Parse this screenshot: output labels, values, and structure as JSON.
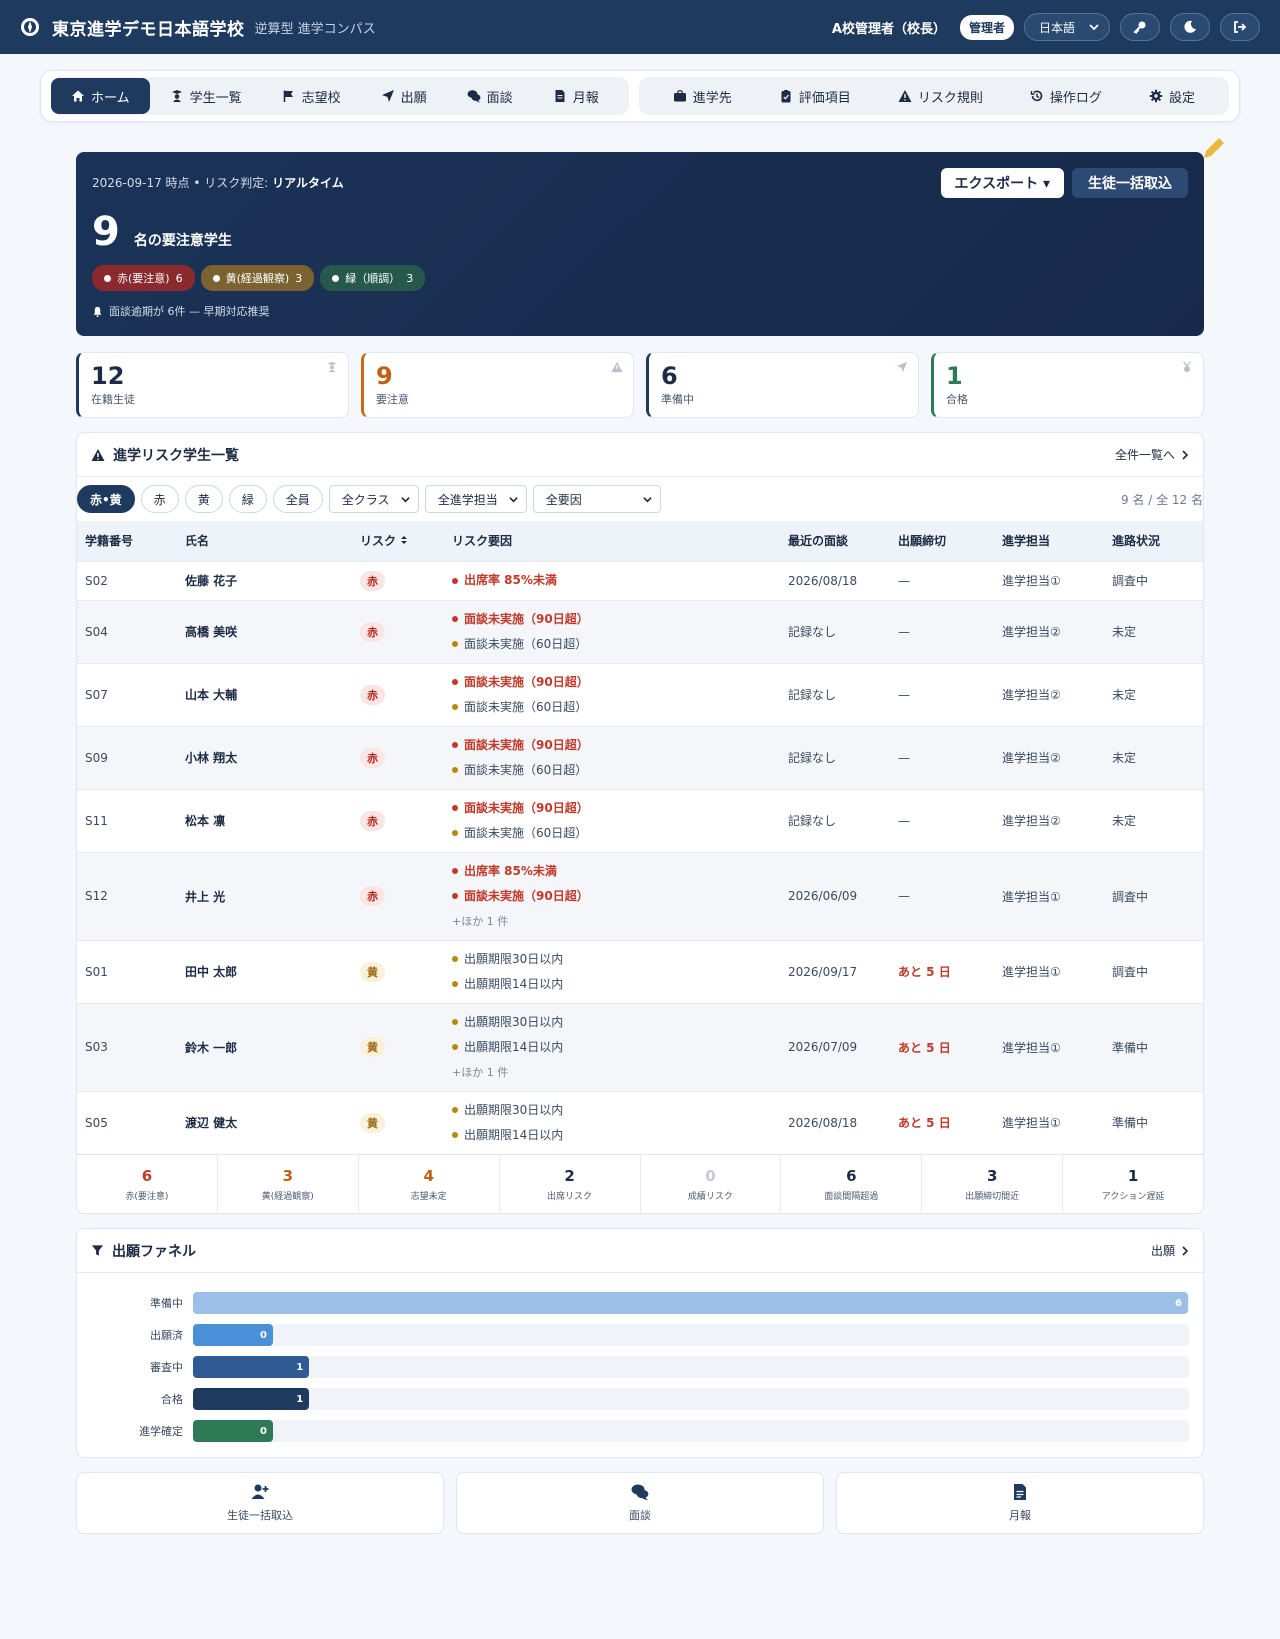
{
  "header": {
    "title": "東京進学デモ日本語学校",
    "subtitle": "逆算型 進学コンパス",
    "user": "A校管理者（校長）",
    "role": "管理者",
    "language": "日本語"
  },
  "nav": {
    "group1": [
      {
        "label": "ホーム",
        "icon": "home-icon",
        "active": true
      },
      {
        "label": "学生一覧",
        "icon": "student-icon"
      },
      {
        "label": "志望校",
        "icon": "flag-icon"
      },
      {
        "label": "出願",
        "icon": "send-icon"
      },
      {
        "label": "面談",
        "icon": "chat-icon"
      },
      {
        "label": "月報",
        "icon": "document-icon"
      }
    ],
    "group2": [
      {
        "label": "進学先",
        "icon": "briefcase-icon"
      },
      {
        "label": "評価項目",
        "icon": "clipboard-icon"
      },
      {
        "label": "リスク規則",
        "icon": "warning-icon"
      },
      {
        "label": "操作ログ",
        "icon": "history-icon"
      },
      {
        "label": "設定",
        "icon": "gear-icon"
      }
    ]
  },
  "hero": {
    "meta_prefix": "2026-09-17 時点 • リスク判定: ",
    "meta_mode": "リアルタイム",
    "count": "9",
    "count_label": "名の要注意学生",
    "pills": [
      {
        "label": "赤(要注意)",
        "count": "6",
        "tone": "red"
      },
      {
        "label": "黄(経過観察)",
        "count": "3",
        "tone": "yellow"
      },
      {
        "label": "緑（順調）",
        "count": "3",
        "tone": "green"
      }
    ],
    "note": "面談逾期が 6件 — 早期対応推奨",
    "export_label": "エクスポート ▾",
    "import_label": "生徒一括取込"
  },
  "kpis": [
    {
      "value": "12",
      "label": "在籍生徒",
      "tone": "navy",
      "icon": "student-icon"
    },
    {
      "value": "9",
      "label": "要注意",
      "tone": "orange",
      "icon": "warning-icon"
    },
    {
      "value": "6",
      "label": "準備中",
      "tone": "navy",
      "icon": "send-icon"
    },
    {
      "value": "1",
      "label": "合格",
      "tone": "green",
      "icon": "medal-icon"
    }
  ],
  "risk_list": {
    "title": "進学リスク学生一覧",
    "link": "全件一覧へ",
    "chips": [
      "赤•黄",
      "赤",
      "黄",
      "緑",
      "全員"
    ],
    "selects": [
      "全クラス",
      "全進学担当",
      "全要因"
    ],
    "count_text": "9 名 / 全 12 名",
    "columns": [
      "学籍番号",
      "氏名",
      "リスク",
      "リスク要因",
      "最近の面談",
      "出願締切",
      "進学担当",
      "進路状況"
    ],
    "rows": [
      {
        "id": "S02",
        "name": "佐藤 花子",
        "risk": "赤",
        "tone": "red",
        "factors": [
          [
            "sev",
            "出席率 85%未満"
          ]
        ],
        "more": "",
        "last": "2026/08/18",
        "deadline": "—",
        "dl_red": false,
        "staff": "進学担当①",
        "status": "調査中"
      },
      {
        "id": "S04",
        "name": "高橋 美咲",
        "risk": "赤",
        "tone": "red",
        "factors": [
          [
            "sev",
            "面談未実施（90日超）"
          ],
          [
            "mild",
            "面談未実施（60日超）"
          ]
        ],
        "more": "",
        "last": "記録なし",
        "deadline": "—",
        "dl_red": false,
        "staff": "進学担当②",
        "status": "未定"
      },
      {
        "id": "S07",
        "name": "山本 大輔",
        "risk": "赤",
        "tone": "red",
        "factors": [
          [
            "sev",
            "面談未実施（90日超）"
          ],
          [
            "mild",
            "面談未実施（60日超）"
          ]
        ],
        "more": "",
        "last": "記録なし",
        "deadline": "—",
        "dl_red": false,
        "staff": "進学担当②",
        "status": "未定"
      },
      {
        "id": "S09",
        "name": "小林 翔太",
        "risk": "赤",
        "tone": "red",
        "factors": [
          [
            "sev",
            "面談未実施（90日超）"
          ],
          [
            "mild",
            "面談未実施（60日超）"
          ]
        ],
        "more": "",
        "last": "記録なし",
        "deadline": "—",
        "dl_red": false,
        "staff": "進学担当②",
        "status": "未定"
      },
      {
        "id": "S11",
        "name": "松本 凛",
        "risk": "赤",
        "tone": "red",
        "factors": [
          [
            "sev",
            "面談未実施（90日超）"
          ],
          [
            "mild",
            "面談未実施（60日超）"
          ]
        ],
        "more": "",
        "last": "記録なし",
        "deadline": "—",
        "dl_red": false,
        "staff": "進学担当②",
        "status": "未定"
      },
      {
        "id": "S12",
        "name": "井上 光",
        "risk": "赤",
        "tone": "red",
        "factors": [
          [
            "sev",
            "出席率 85%未満"
          ],
          [
            "sev",
            "面談未実施（90日超）"
          ]
        ],
        "more": "+ほか 1 件",
        "last": "2026/06/09",
        "deadline": "—",
        "dl_red": false,
        "staff": "進学担当①",
        "status": "調査中"
      },
      {
        "id": "S01",
        "name": "田中 太郎",
        "risk": "黄",
        "tone": "yellow",
        "factors": [
          [
            "mild",
            "出願期限30日以内"
          ],
          [
            "mild",
            "出願期限14日以内"
          ]
        ],
        "more": "",
        "last": "2026/09/17",
        "deadline": "あと 5 日",
        "dl_red": true,
        "staff": "進学担当①",
        "status": "調査中"
      },
      {
        "id": "S03",
        "name": "鈴木 一郎",
        "risk": "黄",
        "tone": "yellow",
        "factors": [
          [
            "mild",
            "出願期限30日以内"
          ],
          [
            "mild",
            "出願期限14日以内"
          ]
        ],
        "more": "+ほか 1 件",
        "last": "2026/07/09",
        "deadline": "あと 5 日",
        "dl_red": true,
        "staff": "進学担当①",
        "status": "準備中"
      },
      {
        "id": "S05",
        "name": "渡辺 健太",
        "risk": "黄",
        "tone": "yellow",
        "factors": [
          [
            "mild",
            "出願期限30日以内"
          ],
          [
            "mild",
            "出願期限14日以内"
          ]
        ],
        "more": "",
        "last": "2026/08/18",
        "deadline": "あと 5 日",
        "dl_red": true,
        "staff": "進学担当①",
        "status": "準備中"
      }
    ],
    "summary": [
      {
        "value": "6",
        "label": "赤(要注意)",
        "color": "#c0392b"
      },
      {
        "value": "3",
        "label": "黄(経過観察)",
        "color": "#c06014"
      },
      {
        "value": "4",
        "label": "志望未定",
        "color": "#c06014"
      },
      {
        "value": "2",
        "label": "出席リスク",
        "color": "#1d2b44"
      },
      {
        "value": "0",
        "label": "成績リスク",
        "color": "#c5ccd6"
      },
      {
        "value": "6",
        "label": "面談間隔超過",
        "color": "#1d2b44"
      },
      {
        "value": "3",
        "label": "出願締切間近",
        "color": "#1d2b44"
      },
      {
        "value": "1",
        "label": "アクション遅延",
        "color": "#1d2b44"
      }
    ]
  },
  "funnel": {
    "title": "出願ファネル",
    "link": "出願",
    "max": 6,
    "stages": [
      {
        "label": "準備中",
        "value": 6,
        "color": "#9bbfe6"
      },
      {
        "label": "出願済",
        "value": 0,
        "color": "#4a90d9"
      },
      {
        "label": "審査中",
        "value": 1,
        "color": "#2f5a94"
      },
      {
        "label": "合格",
        "value": 1,
        "color": "#1e3a5f"
      },
      {
        "label": "進学確定",
        "value": 0,
        "color": "#2e7a56"
      }
    ]
  },
  "quick_links": [
    {
      "label": "生徒一括取込",
      "icon": "user-plus-icon"
    },
    {
      "label": "面談",
      "icon": "chat-icon"
    },
    {
      "label": "月報",
      "icon": "document-icon"
    }
  ]
}
